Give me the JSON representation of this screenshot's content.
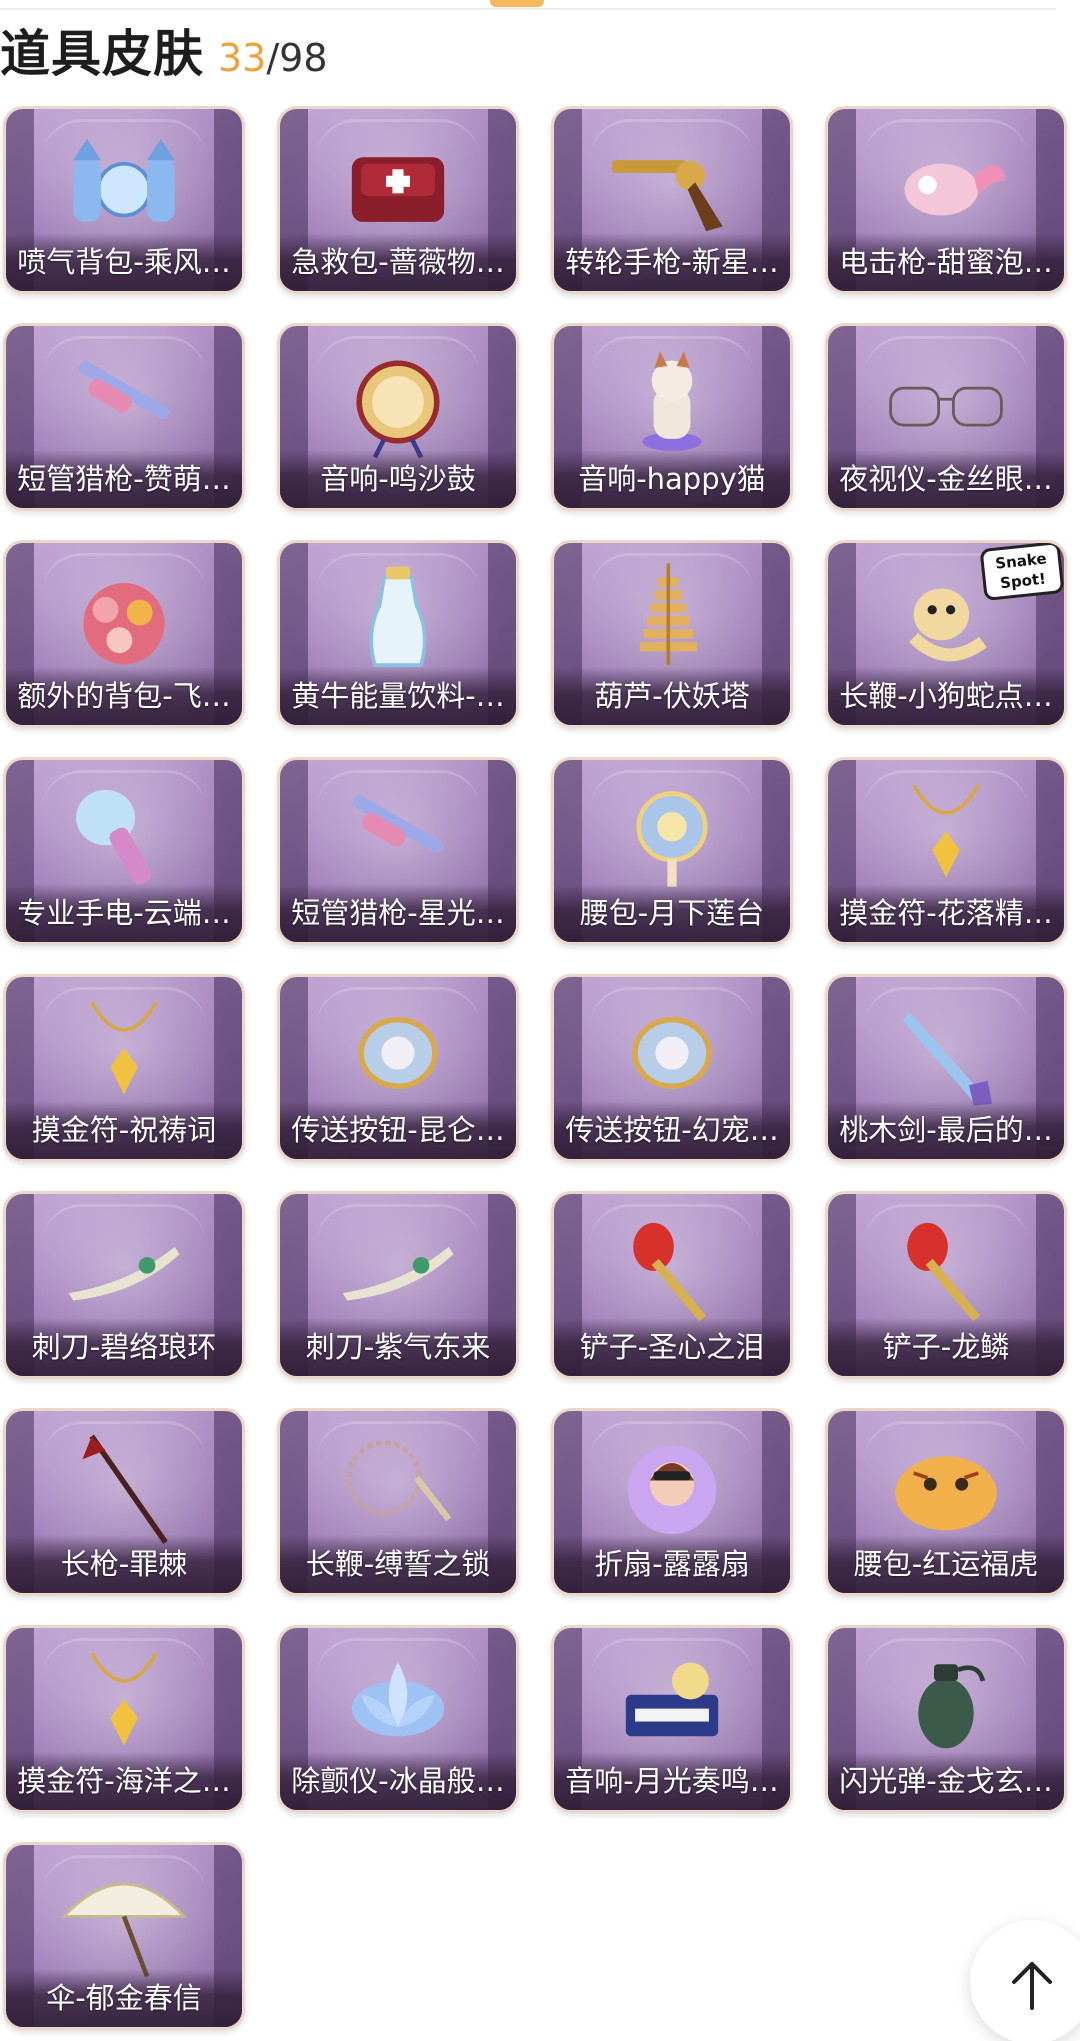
{
  "header": {
    "title": "道具皮肤",
    "owned": "33",
    "separator": "/",
    "total": "98"
  },
  "items": [
    {
      "label": "喷气背包-乘风…",
      "icon": "jetpack-icon"
    },
    {
      "label": "急救包-蔷薇物…",
      "icon": "first-aid-kit-icon"
    },
    {
      "label": "转轮手枪-新星…",
      "icon": "revolver-icon"
    },
    {
      "label": "电击枪-甜蜜泡…",
      "icon": "stun-gun-icon"
    },
    {
      "label": "短管猎枪-赞萌…",
      "icon": "shotgun-icon"
    },
    {
      "label": "音响-鸣沙鼓",
      "icon": "drum-speaker-icon"
    },
    {
      "label": "音响-happy猫",
      "icon": "cat-speaker-icon"
    },
    {
      "label": "夜视仪-金丝眼…",
      "icon": "glasses-icon"
    },
    {
      "label": "额外的背包-飞…",
      "icon": "flower-backpack-icon"
    },
    {
      "label": "黄牛能量饮料-…",
      "icon": "energy-drink-icon"
    },
    {
      "label": "葫芦-伏妖塔",
      "icon": "pagoda-icon"
    },
    {
      "label": "长鞭-小狗蛇点…",
      "icon": "snake-whip-icon",
      "badge": [
        "Snake",
        "Spot!"
      ]
    },
    {
      "label": "专业手电-云端…",
      "icon": "flashlight-icon"
    },
    {
      "label": "短管猎枪-星光…",
      "icon": "shotgun-icon"
    },
    {
      "label": "腰包-月下莲台",
      "icon": "lotus-pouch-icon"
    },
    {
      "label": "摸金符-花落精…",
      "icon": "amulet-icon"
    },
    {
      "label": "摸金符-祝祷词",
      "icon": "amulet-icon"
    },
    {
      "label": "传送按钮-昆仑…",
      "icon": "teleport-button-icon"
    },
    {
      "label": "传送按钮-幻宠…",
      "icon": "teleport-button-icon"
    },
    {
      "label": "桃木剑-最后的…",
      "icon": "sword-icon"
    },
    {
      "label": "刺刀-碧络琅环",
      "icon": "dagger-icon"
    },
    {
      "label": "刺刀-紫气东来",
      "icon": "dagger-icon"
    },
    {
      "label": "铲子-圣心之泪",
      "icon": "shovel-icon"
    },
    {
      "label": "铲子-龙鳞",
      "icon": "shovel-icon"
    },
    {
      "label": "长枪-罪棘",
      "icon": "spear-icon"
    },
    {
      "label": "长鞭-缚誓之锁",
      "icon": "chain-whip-icon"
    },
    {
      "label": "折扇-露露扇",
      "icon": "fan-icon"
    },
    {
      "label": "腰包-红运福虎",
      "icon": "tiger-pouch-icon"
    },
    {
      "label": "摸金符-海洋之…",
      "icon": "amulet-icon"
    },
    {
      "label": "除颤仪-冰晶般…",
      "icon": "lotus-defibrillator-icon"
    },
    {
      "label": "音响-月光奏鸣…",
      "icon": "piano-speaker-icon"
    },
    {
      "label": "闪光弹-金戈玄…",
      "icon": "grenade-icon"
    },
    {
      "label": "伞-郁金春信",
      "icon": "umbrella-icon"
    }
  ],
  "colors": {
    "accent": "#f0a23a",
    "card_bg": "#a584bd",
    "card_border": "#e9d7c9"
  },
  "scroll_top_icon": "arrow-up-icon"
}
